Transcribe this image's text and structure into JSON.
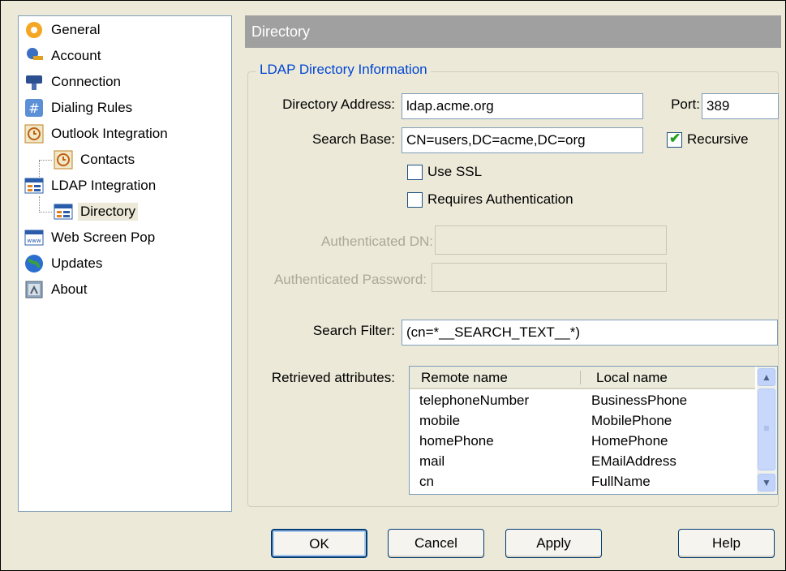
{
  "tree": {
    "items": [
      {
        "label": "General",
        "icon": "gear-icon"
      },
      {
        "label": "Account",
        "icon": "account-key-icon"
      },
      {
        "label": "Connection",
        "icon": "plug-icon"
      },
      {
        "label": "Dialing Rules",
        "icon": "hash-icon"
      },
      {
        "label": "Outlook Integration",
        "icon": "clock-icon"
      },
      {
        "label": "Contacts",
        "icon": "clock-icon"
      },
      {
        "label": "LDAP Integration",
        "icon": "directory-icon"
      },
      {
        "label": "Directory",
        "icon": "directory-icon"
      },
      {
        "label": "Web Screen Pop",
        "icon": "web-window-icon"
      },
      {
        "label": "Updates",
        "icon": "globe-icon"
      },
      {
        "label": "About",
        "icon": "about-icon"
      }
    ]
  },
  "header": {
    "title": "Directory"
  },
  "group": {
    "title": "LDAP Directory Information"
  },
  "form": {
    "address_label": "Directory Address:",
    "address_value": "ldap.acme.org",
    "port_label": "Port:",
    "port_value": "389",
    "search_base_label": "Search Base:",
    "search_base_value": "CN=users,DC=acme,DC=org",
    "recursive_label": "Recursive",
    "use_ssl_label": "Use SSL",
    "requires_auth_label": "Requires Authentication",
    "auth_dn_label": "Authenticated DN:",
    "auth_pw_label": "Authenticated Password:",
    "search_filter_label": "Search Filter:",
    "search_filter_value": "(cn=*__SEARCH_TEXT__*)",
    "retrieved_label": "Retrieved attributes:"
  },
  "attributes": {
    "columns": [
      "Remote name",
      "Local name"
    ],
    "rows": [
      [
        "telephoneNumber",
        "BusinessPhone"
      ],
      [
        "mobile",
        "MobilePhone"
      ],
      [
        "homePhone",
        "HomePhone"
      ],
      [
        "mail",
        "EMailAddress"
      ],
      [
        "cn",
        "FullName"
      ]
    ]
  },
  "buttons": {
    "ok": "OK",
    "cancel": "Cancel",
    "apply": "Apply",
    "help": "Help"
  },
  "colors": {
    "accent_title": "#0046d5",
    "header_bg": "#a0a0a0",
    "check": "#21a121"
  }
}
